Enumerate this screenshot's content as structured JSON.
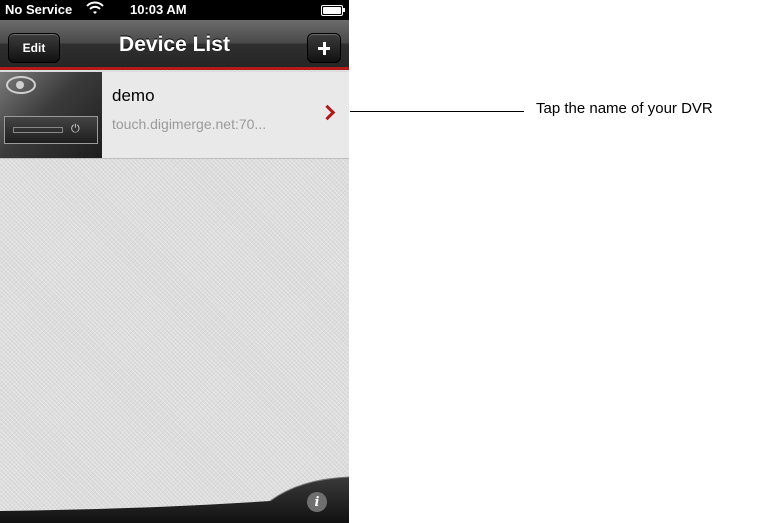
{
  "status_bar": {
    "carrier": "No Service",
    "time": "10:03 AM"
  },
  "navbar": {
    "edit_label": "Edit",
    "title": "Device List"
  },
  "devices": [
    {
      "name": "demo",
      "address": "touch.digimerge.net:70..."
    }
  ],
  "callout": {
    "text": "Tap the name of your DVR"
  },
  "colors": {
    "accent": "#b31b1b",
    "navbar": "#3a3a3a",
    "list_background": "#dcdcdc"
  },
  "icons": [
    "wifi-icon",
    "battery-icon",
    "plus-icon",
    "chevron-right-icon",
    "info-icon"
  ]
}
